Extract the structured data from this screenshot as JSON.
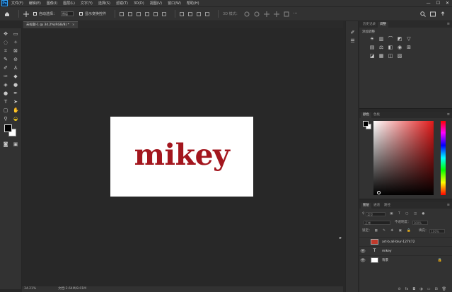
{
  "app": {
    "logo": "Ps"
  },
  "menu": [
    "文件(F)",
    "编辑(E)",
    "图像(I)",
    "图层(L)",
    "文字(Y)",
    "选择(S)",
    "滤镜(T)",
    "3D(D)",
    "视图(V)",
    "窗口(W)",
    "帮助(H)"
  ],
  "window_controls": {
    "minimize": "—",
    "maximize": "☐",
    "close": "✕"
  },
  "options": {
    "auto_select_label": "自动选择：",
    "auto_select_value": "图层",
    "show_transform_label": "显示变换控件",
    "mode_3d_label": "3D 模式："
  },
  "document": {
    "tab_title": "未标题-1 @ 34.2%(RGB/8) *",
    "tab_close": "×",
    "artwork_text": "mikey",
    "artwork_color": "#a3161e"
  },
  "status": {
    "zoom": "34.21%",
    "doc_info": "文档:2.64M/8.01M"
  },
  "panels": {
    "history_tabs": [
      "历史记录",
      "调整"
    ],
    "adjust_label": "添加调整",
    "color_tabs": [
      "颜色",
      "色板"
    ],
    "layers_tabs": [
      "图层",
      "通道",
      "路径"
    ],
    "layers_filter": "类型",
    "blend_mode": "正常",
    "opacity_label": "不透明度：",
    "opacity_value": "100%",
    "lock_label": "锁定：",
    "fill_label": "填充：",
    "fill_value": "100%",
    "layers": [
      {
        "name": "art-b.all-blur-127472",
        "kind": "image",
        "visible": false
      },
      {
        "name": "mikey",
        "kind": "text",
        "visible": true
      },
      {
        "name": "背景",
        "kind": "background",
        "visible": true,
        "locked": true
      }
    ]
  },
  "colors": {
    "foreground": "#000000",
    "background": "#ffffff",
    "accent": "#31a8ff"
  }
}
